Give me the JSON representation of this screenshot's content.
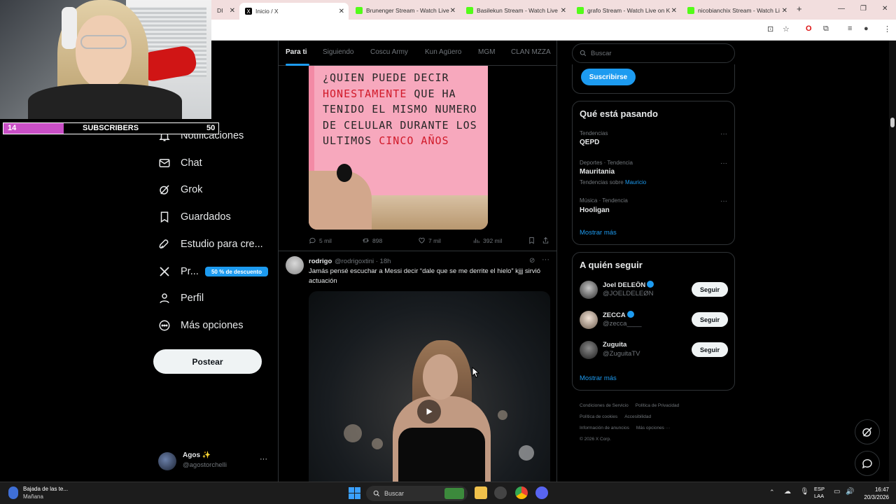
{
  "browser": {
    "tabs": [
      {
        "label": "DI",
        "type": "partial"
      },
      {
        "label": "Inicio / X",
        "type": "x",
        "active": true
      },
      {
        "label": "Brunenger Stream - Watch Live",
        "type": "kick"
      },
      {
        "label": "Basilekun Stream - Watch Live",
        "type": "kick"
      },
      {
        "label": "grafo Stream - Watch Live on K",
        "type": "kick"
      },
      {
        "label": "nicobianchix Stream - Watch Li",
        "type": "kick"
      }
    ]
  },
  "overlay": {
    "sub_count": "14",
    "sub_label": "SUBSCRIBERS",
    "sub_goal": "50",
    "sub_progress": 0.28
  },
  "nav": {
    "items": [
      {
        "label": "Notificaciones",
        "icon": "bell-icon"
      },
      {
        "label": "Chat",
        "icon": "mail-icon"
      },
      {
        "label": "Grok",
        "icon": "grok-icon"
      },
      {
        "label": "Guardados",
        "icon": "bookmark-icon"
      },
      {
        "label": "Estudio para cre...",
        "icon": "rocket-icon"
      },
      {
        "label": "Pr...",
        "icon": "x-logo-icon"
      },
      {
        "label": "Perfil",
        "icon": "person-icon"
      },
      {
        "label": "Más opciones",
        "icon": "more-circle-icon"
      }
    ],
    "premium_badge": "50 % de descuento",
    "post_button": "Postear",
    "account": {
      "name": "Agos ✨",
      "handle": "@agostorchelli"
    }
  },
  "feed": {
    "tabs": [
      "Para ti",
      "Siguiendo",
      "Coscu Army",
      "Kun Agüero",
      "MGM",
      "CLAN MZZA"
    ],
    "active_tab": 0,
    "tweet1": {
      "image_text": [
        {
          "text": "¿Quien puede decir",
          "red": false
        },
        {
          "text": "honestamente",
          "red": true,
          "suffix": " que ha"
        },
        {
          "text": "tenido el mismo numero",
          "red": false
        },
        {
          "text": "de celular durante los",
          "red": false
        },
        {
          "text": "ultimos ",
          "red": false,
          "red_suffix": "cinco años"
        }
      ],
      "replies": "5 mil",
      "retweets": "898",
      "likes": "7 mil",
      "views": "392 mil"
    },
    "tweet2": {
      "name": "rodrigo",
      "handle": "@rodrigoxtini · 18h",
      "text": "Jamás pensé escuchar a Messi decir “dale que se me derrite el hielo” kjjj sirvió actuación"
    }
  },
  "sidebar": {
    "search_placeholder": "Buscar",
    "subscribe_label": "Suscribirse",
    "trends_title": "Qué está pasando",
    "trends": [
      {
        "category": "Tendencias",
        "name": "QEPD",
        "extra_prefix": "",
        "extra_link": ""
      },
      {
        "category": "Deportes · Tendencia",
        "name": "Mauritania",
        "extra_prefix": "Tendencias sobre ",
        "extra_link": "Mauricio"
      },
      {
        "category": "Música · Tendencia",
        "name": "Hooligan",
        "extra_prefix": "",
        "extra_link": ""
      }
    ],
    "show_more": "Mostrar más",
    "follow_title": "A quién seguir",
    "follow": [
      {
        "name": "Joel DELEÖN",
        "handle": "@JOELDELEØN",
        "verified": true,
        "button": "Seguir"
      },
      {
        "name": "ZECCA",
        "handle": "@zecca____",
        "verified": true,
        "button": "Seguir"
      },
      {
        "name": "Zuguita",
        "handle": "@ZuguitaTV",
        "verified": false,
        "button": "Seguir"
      }
    ],
    "show_more2": "Mostrar más",
    "footer": [
      "Condiciones de Servicio",
      "Política de Privacidad",
      "Política de cookies",
      "Accesibilidad",
      "Información de anuncios",
      "Más opciones ···",
      "© 2026 X Corp."
    ]
  },
  "taskbar": {
    "weather_title": "Bajada de las te...",
    "weather_sub": "Mañana",
    "search_label": "Buscar",
    "lang": "ESP",
    "lang2": "LAA",
    "time": "16:47",
    "date": "20/3/2026"
  }
}
